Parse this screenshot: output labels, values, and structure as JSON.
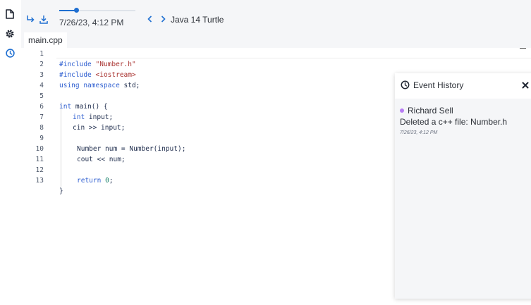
{
  "activity_bar": {
    "items": [
      {
        "icon": "file-icon"
      },
      {
        "icon": "gear-icon"
      },
      {
        "icon": "clock-icon",
        "active": true
      }
    ]
  },
  "toolbar": {
    "timeline_position": 0.22,
    "timestamp": "7/26/23, 4:12 PM",
    "project_title": "Java 14 Turtle"
  },
  "editor": {
    "active_tab": "main.cpp",
    "lines": [
      {
        "n": "1"
      },
      {
        "n": "2"
      },
      {
        "n": "3"
      },
      {
        "n": "4"
      },
      {
        "n": "5"
      },
      {
        "n": "6"
      },
      {
        "n": "7"
      },
      {
        "n": "8"
      },
      {
        "n": "9"
      },
      {
        "n": "10"
      },
      {
        "n": "11"
      },
      {
        "n": "12"
      },
      {
        "n": "13"
      }
    ],
    "code": {
      "l1_kw": "#include",
      "l1_str": "\"Number.h\"",
      "l2_kw": "#include",
      "l2_str": "<iostream>",
      "l3_kw": "using namespace",
      "l3_rest": " std;",
      "l5_kw": "int",
      "l5_rest": " main() {",
      "l6_kw": "int",
      "l6_rest": " input;",
      "l7": "cin >> input;",
      "l9": "Number num = Number(input);",
      "l10": "cout << num;",
      "l12_kw": "return",
      "l12_num": "0",
      "l12_semi": ";",
      "l13": "}"
    }
  },
  "event_history": {
    "title": "Event History",
    "events": [
      {
        "user": "Richard Sell",
        "description": "Deleted a c++ file: Number.h",
        "time": "7/26/23, 4:12 PM",
        "dot_color": "#b77cf3"
      }
    ]
  },
  "colors": {
    "accent": "#1f6fd1",
    "keyword": "#2f5fd0",
    "string": "#a8322f",
    "number": "#19836a"
  }
}
